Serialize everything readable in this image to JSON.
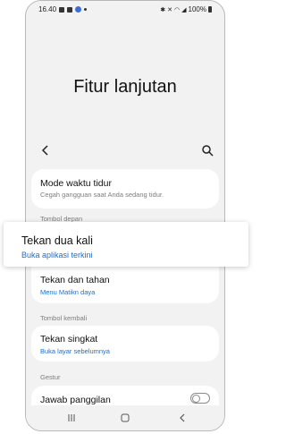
{
  "status_bar": {
    "time": "16.40",
    "battery": "100%"
  },
  "page": {
    "title": "Fitur lanjutan"
  },
  "colors": {
    "accent": "#1a6fcf",
    "subtitle_gray": "#7d7d7d",
    "card_bg": "#ffffff",
    "screen_bg": "#f2f2f2"
  },
  "settings": {
    "sleep_mode": {
      "title": "Mode waktu tidur",
      "subtitle": "Cegah gangguan saat Anda sedang tidur."
    },
    "section_front_key": "Tombol depan",
    "double_press": {
      "title": "Tekan dua kali",
      "subtitle": "Buka aplikasi terkini"
    },
    "press_hold": {
      "title": "Tekan dan tahan",
      "subtitle": "Menu Matikn daya"
    },
    "section_back_key": "Tombol kembali",
    "short_press": {
      "title": "Tekan singkat",
      "subtitle": "Buka layar sebelumnya"
    },
    "section_gestures": "Gestur",
    "answer_call": {
      "title": "Jawab panggilan",
      "enabled": false
    }
  },
  "icons": {
    "back": "chevron-left-icon",
    "search": "search-icon",
    "nav_recent": "recent-apps-icon",
    "nav_home": "home-icon",
    "nav_back": "back-icon"
  }
}
